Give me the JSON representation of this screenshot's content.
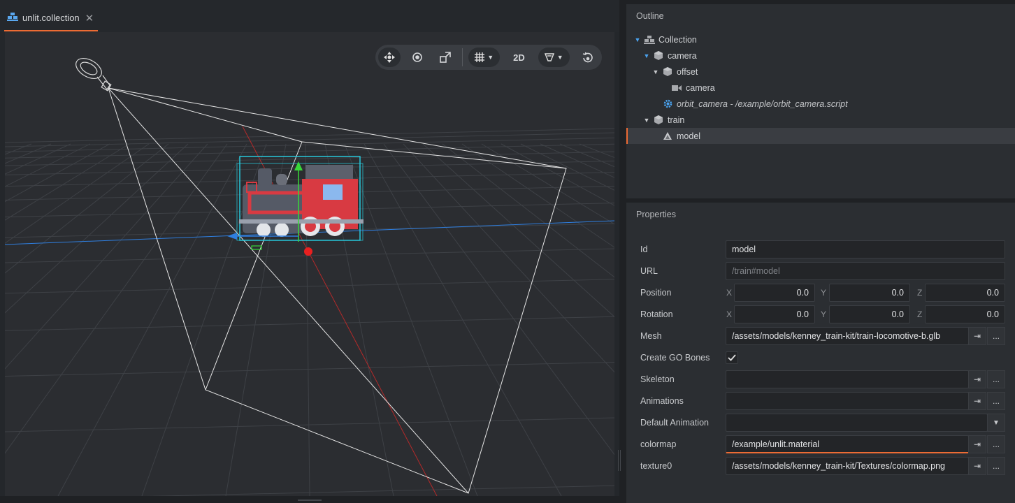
{
  "tab": {
    "title": "unlit.collection",
    "close": "✕",
    "icon": "collection-icon"
  },
  "toolbar": {
    "move_icon": "move-icon",
    "rotate_icon": "rotate-icon",
    "scale_icon": "scale-icon",
    "grid_icon": "grid-icon",
    "mode_2d": "2D",
    "visibility_icon": "visibility-filter-icon",
    "camera_icon": "camera-reset-icon"
  },
  "outline": {
    "title": "Outline",
    "items": [
      {
        "label": "Collection",
        "icon": "collection-icon",
        "expanded": true
      },
      {
        "label": "camera",
        "icon": "gameobject-icon",
        "expanded": true
      },
      {
        "label": "offset",
        "icon": "gameobject-icon",
        "expanded": true
      },
      {
        "label": "camera",
        "icon": "camera-component-icon"
      },
      {
        "label": "orbit_camera - /example/orbit_camera.script",
        "icon": "script-gear-icon"
      },
      {
        "label": "train",
        "icon": "gameobject-icon",
        "expanded": true
      },
      {
        "label": "model",
        "icon": "model-icon",
        "selected": true
      }
    ]
  },
  "properties": {
    "title": "Properties",
    "id": {
      "label": "Id",
      "value": "model"
    },
    "url": {
      "label": "URL",
      "placeholder": "/train#model"
    },
    "position": {
      "label": "Position",
      "x": "0.0",
      "y": "0.0",
      "z": "0.0"
    },
    "rotation": {
      "label": "Rotation",
      "x": "0.0",
      "y": "0.0",
      "z": "0.0"
    },
    "axis_x": "X",
    "axis_y": "Y",
    "axis_z": "Z",
    "mesh": {
      "label": "Mesh",
      "value": "/assets/models/kenney_train-kit/train-locomotive-b.glb"
    },
    "create_go_bones": {
      "label": "Create GO Bones",
      "checked": true
    },
    "skeleton": {
      "label": "Skeleton",
      "value": ""
    },
    "animations": {
      "label": "Animations",
      "value": ""
    },
    "default_animation": {
      "label": "Default Animation",
      "value": ""
    },
    "colormap": {
      "label": "colormap",
      "value": "/example/unlit.material"
    },
    "texture0": {
      "label": "texture0",
      "value": "/assets/models/kenney_train-kit/Textures/colormap.png"
    },
    "goto_glyph": "⇥",
    "browse_glyph": "..."
  }
}
